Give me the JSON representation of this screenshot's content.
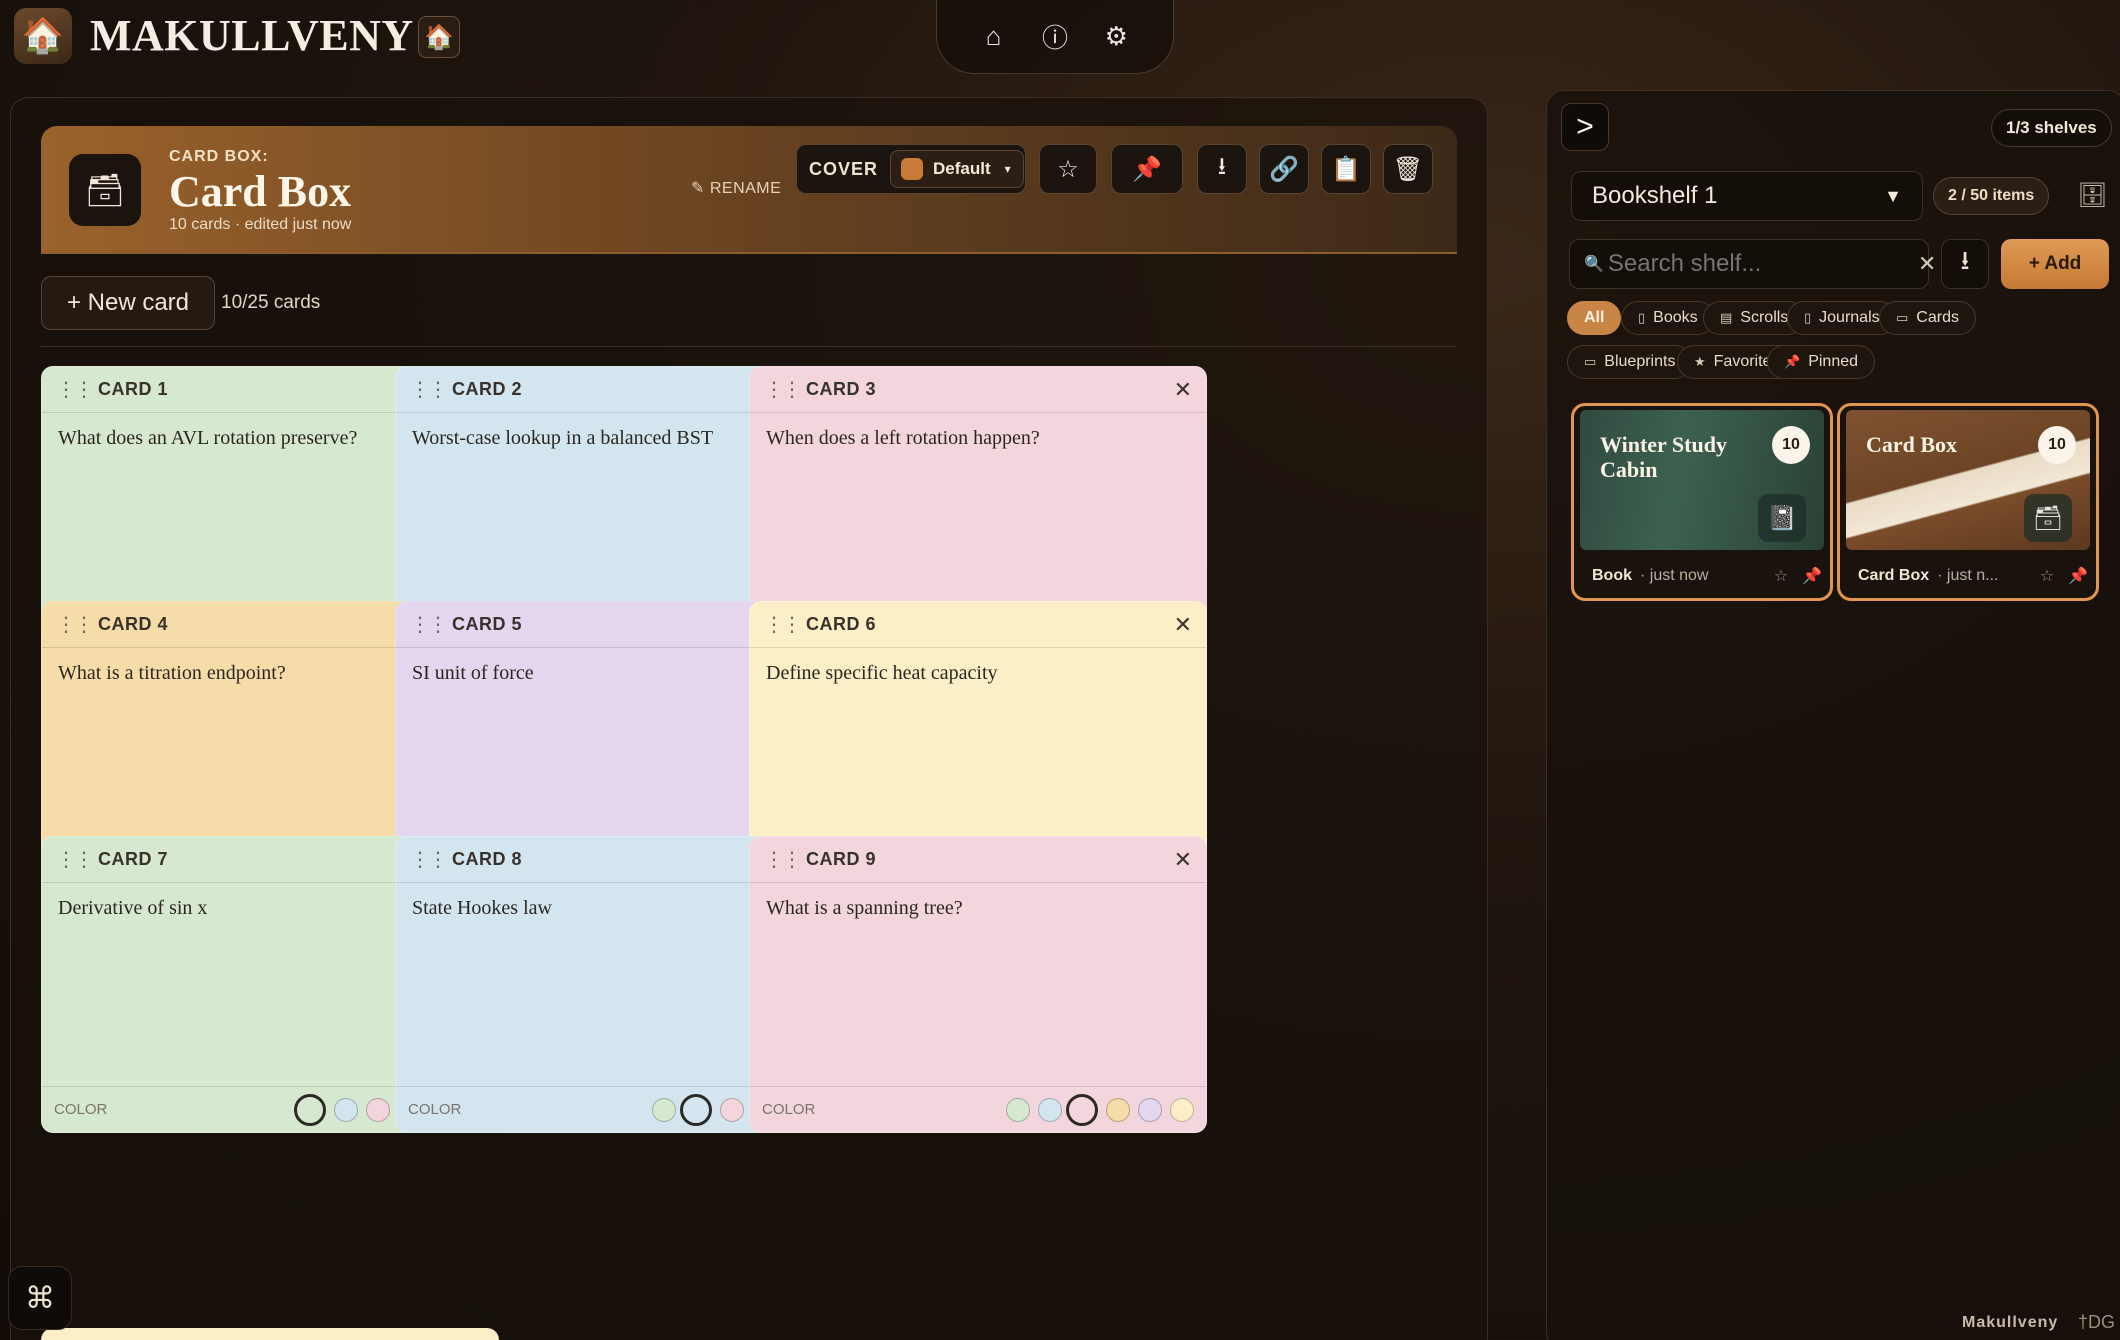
{
  "app": {
    "title": "MAKULLVENY"
  },
  "nav": {
    "home": "⌂",
    "info": "ⓘ",
    "settings": "⚙"
  },
  "box": {
    "kicker": "CARD BOX:",
    "title": "Card Box",
    "meta": "10 cards · edited just now",
    "rename_label": "✎ RENAME",
    "cover_label": "COVER",
    "cover_value": "Default"
  },
  "toolbar": {
    "new_card_label": "+ New card",
    "card_count": "10/25 cards"
  },
  "cards": [
    {
      "title": "CARD 1",
      "text": "What does an AVL rotation preserve?",
      "color": "green"
    },
    {
      "title": "CARD 2",
      "text": "Worst-case lookup in a balanced BST",
      "color": "blue"
    },
    {
      "title": "CARD 3",
      "text": "When does a left rotation happen?",
      "color": "pink"
    },
    {
      "title": "CARD 4",
      "text": "What is a titration endpoint?",
      "color": "orange"
    },
    {
      "title": "CARD 5",
      "text": "SI unit of force",
      "color": "purple"
    },
    {
      "title": "CARD 6",
      "text": "Define specific heat capacity",
      "color": "yellow"
    },
    {
      "title": "CARD 7",
      "text": "Derivative of sin x",
      "color": "green"
    },
    {
      "title": "CARD 8",
      "text": "State Hookes law",
      "color": "blue"
    },
    {
      "title": "CARD 9",
      "text": "What is a spanning tree?",
      "color": "pink"
    }
  ],
  "card_labels": {
    "color": "COLOR"
  },
  "palette": [
    "green",
    "blue",
    "pink",
    "orange",
    "purple",
    "yellow"
  ],
  "shelf": {
    "shelves_count": "1/3 shelves",
    "selected_shelf": "Bookshelf 1",
    "items_count": "2 / 50 items",
    "search_placeholder": "Search shelf...",
    "add_label": "+ Add",
    "filters": [
      {
        "label": "All",
        "icon": ""
      },
      {
        "label": "Books",
        "icon": "▯"
      },
      {
        "label": "Scrolls",
        "icon": "▤"
      },
      {
        "label": "Journals",
        "icon": "▯"
      },
      {
        "label": "Cards",
        "icon": "▭"
      },
      {
        "label": "Blueprints",
        "icon": "▭"
      },
      {
        "label": "Favorites",
        "icon": "★"
      },
      {
        "label": "Pinned",
        "icon": "📌"
      }
    ],
    "items": [
      {
        "title": "Winter Study Cabin",
        "count": "10",
        "type": "Book",
        "time": "· just now"
      },
      {
        "title": "Card Box",
        "count": "10",
        "type": "Card Box",
        "time": "· just n..."
      }
    ]
  },
  "footer": {
    "brand": "Makullveny",
    "mark": "†DG"
  }
}
